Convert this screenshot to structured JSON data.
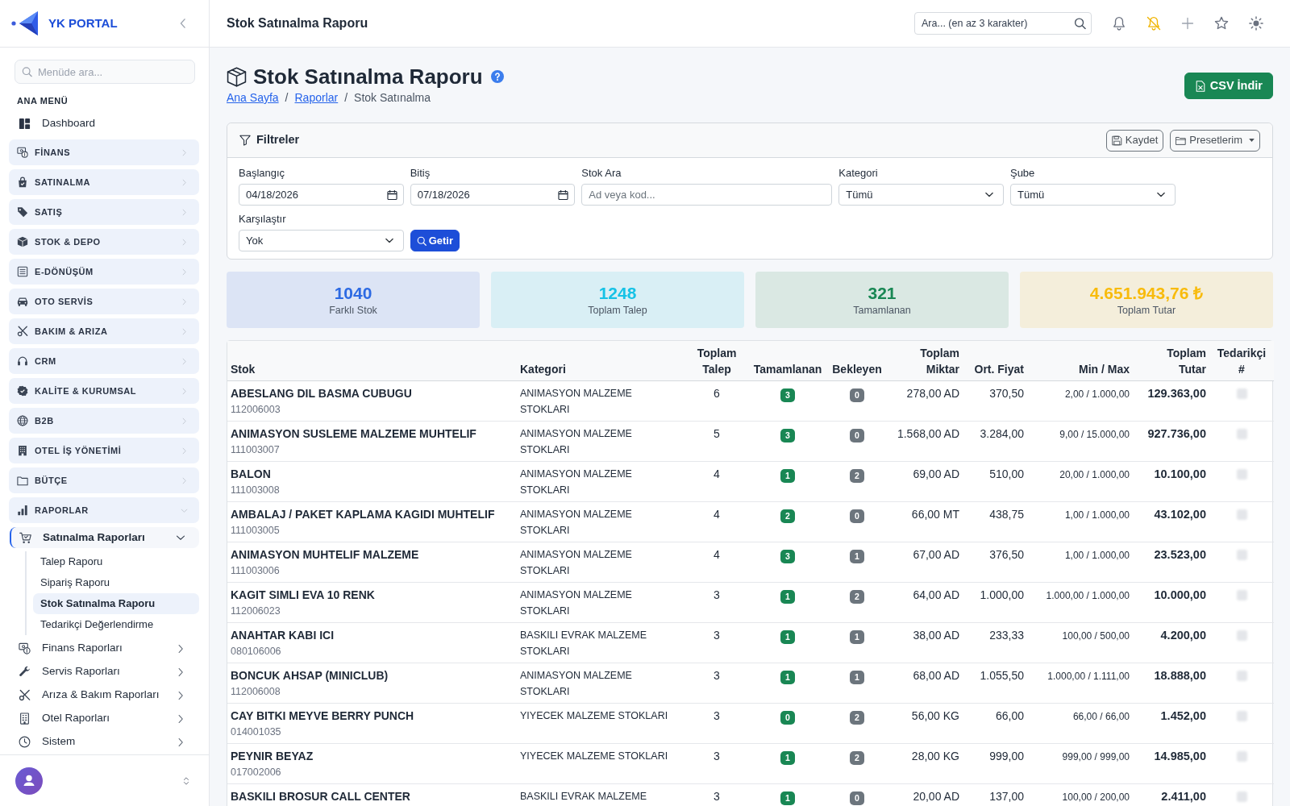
{
  "sidebar": {
    "brand": "YK PORTAL",
    "search": {
      "placeholder": "Menüde ara..."
    },
    "section_label": "ANA MENÜ",
    "items": [
      {
        "label": "Dashboard",
        "kind": "link"
      },
      {
        "label": "FİNANS",
        "kind": "group",
        "expanded": false
      },
      {
        "label": "SATINALMA",
        "kind": "group",
        "expanded": false
      },
      {
        "label": "SATIŞ",
        "kind": "group",
        "expanded": false
      },
      {
        "label": "STOK & DEPO",
        "kind": "group",
        "expanded": false
      },
      {
        "label": "E-DÖNÜŞÜM",
        "kind": "group",
        "expanded": false
      },
      {
        "label": "OTO SERVİS",
        "kind": "group",
        "expanded": false
      },
      {
        "label": "BAKIM & ARIZA",
        "kind": "group",
        "expanded": false
      },
      {
        "label": "CRM",
        "kind": "group",
        "expanded": false
      },
      {
        "label": "KALİTE & KURUMSAL",
        "kind": "group",
        "expanded": false
      },
      {
        "label": "B2B",
        "kind": "group",
        "expanded": false
      },
      {
        "label": "OTEL İŞ YÖNETİMİ",
        "kind": "group",
        "expanded": false
      },
      {
        "label": "BÜTÇE",
        "kind": "group",
        "expanded": false
      },
      {
        "label": "RAPORLAR",
        "kind": "group",
        "expanded": true,
        "children": [
          {
            "label": "Satınalma Raporları",
            "expanded": true,
            "children": [
              {
                "label": "Talep Raporu",
                "selected": false
              },
              {
                "label": "Sipariş Raporu",
                "selected": false
              },
              {
                "label": "Stok Satınalma Raporu",
                "selected": true
              },
              {
                "label": "Tedarikçi Değerlendirme",
                "selected": false
              }
            ]
          },
          {
            "label": "Finans Raporları",
            "expanded": false
          },
          {
            "label": "Servis Raporları",
            "expanded": false
          },
          {
            "label": "Arıza & Bakım Raporları",
            "expanded": false
          },
          {
            "label": "Otel Raporları",
            "expanded": false
          },
          {
            "label": "Sistem",
            "expanded": false
          }
        ]
      }
    ]
  },
  "topbar": {
    "title": "Stok Satınalma Raporu",
    "search": {
      "placeholder": "Ara... (en az 3 karakter)"
    }
  },
  "page_header": {
    "title": "Stok Satınalma Raporu",
    "breadcrumb": [
      {
        "label": "Ana Sayfa",
        "kind": "link"
      },
      {
        "label": "/",
        "kind": "separator"
      },
      {
        "label": "Raporlar",
        "kind": "link"
      },
      {
        "label": "/",
        "kind": "separator"
      },
      {
        "label": "Stok Satınalma",
        "kind": "current"
      }
    ],
    "actions": [
      "CSV İndir"
    ]
  },
  "filters": {
    "title": "Filtreler",
    "buttons": [
      {
        "label": "Kaydet",
        "kind": "button"
      },
      {
        "label": "Presetlerim",
        "kind": "dropdown"
      }
    ],
    "fields": [
      {
        "label": "Başlangıç",
        "kind": "date",
        "value": "04/18/2026"
      },
      {
        "label": "Bitiş",
        "kind": "date",
        "value": "07/18/2026"
      },
      {
        "label": "Stok Ara",
        "kind": "text",
        "placeholder": "Ad veya kod..."
      },
      {
        "label": "Kategori",
        "kind": "select",
        "value": "Tümü"
      },
      {
        "label": "Şube",
        "kind": "select",
        "value": "Tümü"
      },
      {
        "label": "Karşılaştır",
        "kind": "select",
        "value": "Yok"
      }
    ],
    "submit": "Getir"
  },
  "stats": [
    {
      "value": "1040",
      "label": "Farklı Stok",
      "color": "#2d6ae3"
    },
    {
      "value": "1248",
      "label": "Toplam Talep",
      "color": "#16c2e6"
    },
    {
      "value": "321",
      "label": "Tamamlanan",
      "color": "#198754"
    },
    {
      "value": "4.651.943,76 ₺",
      "label": "Toplam Tutar",
      "color": "#f8bb0c"
    }
  ],
  "table": {
    "columns": [
      "Stok",
      "Kategori",
      "Toplam Talep",
      "Tamamlanan",
      "Bekleyen",
      "Toplam Miktar",
      "Ort. Fiyat",
      "Min / Max",
      "Toplam Tutar",
      "Tedarikçi #"
    ],
    "rows": [
      {
        "name": "ABESLANG DIL BASMA CUBUGU",
        "code": "112006003",
        "category": "ANIMASYON MALZEME STOKLARI",
        "requested": "6",
        "completed": "3",
        "pending": "0",
        "quantity": "278,00 AD",
        "avg_price": "370,50",
        "min_max": "2,00 / 1.000,00",
        "total": "129.363,00"
      },
      {
        "name": "ANIMASYON SUSLEME MALZEME MUHTELIF",
        "code": "111003007",
        "category": "ANIMASYON MALZEME STOKLARI",
        "requested": "5",
        "completed": "3",
        "pending": "0",
        "quantity": "1.568,00 AD",
        "avg_price": "3.284,00",
        "min_max": "9,00 / 15.000,00",
        "total": "927.736,00"
      },
      {
        "name": "BALON",
        "code": "111003008",
        "category": "ANIMASYON MALZEME STOKLARI",
        "requested": "4",
        "completed": "1",
        "pending": "2",
        "quantity": "69,00 AD",
        "avg_price": "510,00",
        "min_max": "20,00 / 1.000,00",
        "total": "10.100,00"
      },
      {
        "name": "AMBALAJ / PAKET KAPLAMA KAGIDI MUHTELIF",
        "code": "111003005",
        "category": "ANIMASYON MALZEME STOKLARI",
        "requested": "4",
        "completed": "2",
        "pending": "0",
        "quantity": "66,00 MT",
        "avg_price": "438,75",
        "min_max": "1,00 / 1.000,00",
        "total": "43.102,00"
      },
      {
        "name": "ANIMASYON MUHTELIF MALZEME",
        "code": "111003006",
        "category": "ANIMASYON MALZEME STOKLARI",
        "requested": "4",
        "completed": "3",
        "pending": "1",
        "quantity": "67,00 AD",
        "avg_price": "376,50",
        "min_max": "1,00 / 1.000,00",
        "total": "23.523,00"
      },
      {
        "name": "KAGIT SIMLI EVA 10 RENK",
        "code": "112006023",
        "category": "ANIMASYON MALZEME STOKLARI",
        "requested": "3",
        "completed": "1",
        "pending": "2",
        "quantity": "64,00 AD",
        "avg_price": "1.000,00",
        "min_max": "1.000,00 / 1.000,00",
        "total": "10.000,00"
      },
      {
        "name": "ANAHTAR KABI ICI",
        "code": "080106006",
        "category": "BASKILI EVRAK MALZEME STOKLARI",
        "requested": "3",
        "completed": "1",
        "pending": "1",
        "quantity": "38,00 AD",
        "avg_price": "233,33",
        "min_max": "100,00 / 500,00",
        "total": "4.200,00"
      },
      {
        "name": "BONCUK AHSAP (MINICLUB)",
        "code": "112006008",
        "category": "ANIMASYON MALZEME STOKLARI",
        "requested": "3",
        "completed": "1",
        "pending": "1",
        "quantity": "68,00 AD",
        "avg_price": "1.055,50",
        "min_max": "1.000,00 / 1.111,00",
        "total": "18.888,00"
      },
      {
        "name": "CAY BITKI MEYVE BERRY PUNCH",
        "code": "014001035",
        "category": "YIYECEK MALZEME STOKLARI",
        "requested": "3",
        "completed": "0",
        "pending": "2",
        "quantity": "56,00 KG",
        "avg_price": "66,00",
        "min_max": "66,00 / 66,00",
        "total": "1.452,00"
      },
      {
        "name": "PEYNIR BEYAZ",
        "code": "017002006",
        "category": "YIYECEK MALZEME STOKLARI",
        "requested": "3",
        "completed": "1",
        "pending": "2",
        "quantity": "28,00 KG",
        "avg_price": "999,00",
        "min_max": "999,00 / 999,00",
        "total": "14.985,00"
      },
      {
        "name": "BASKILI BROSUR CALL CENTER",
        "category": "BASKILI EVRAK MALZEME",
        "requested": "3",
        "completed": "1",
        "pending": "0",
        "quantity": "20,00 AD",
        "avg_price": "137,00",
        "min_max": "100,00 / 200,00",
        "total": "2.411,00"
      }
    ]
  }
}
